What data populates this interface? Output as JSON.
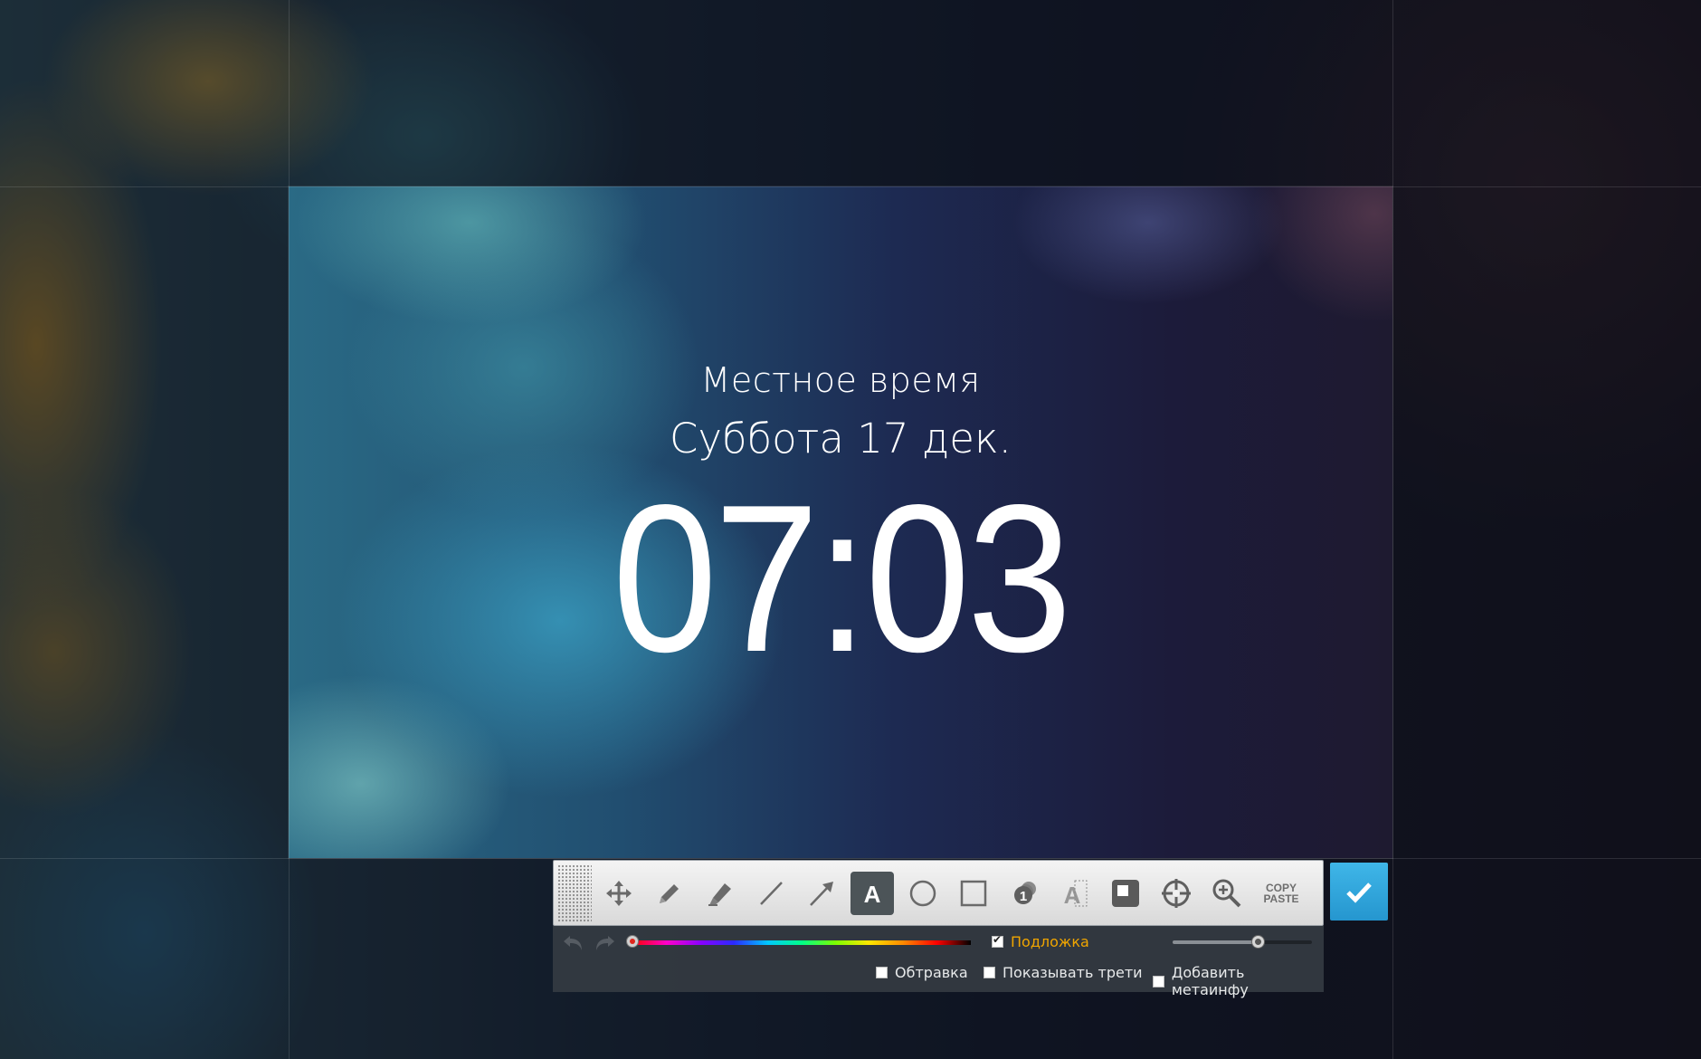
{
  "lockscreen": {
    "label": "Местное время",
    "date": "Суббота 17 дек.",
    "time": "07:03"
  },
  "toolbar": {
    "tools": [
      {
        "name": "move-tool",
        "icon": "move-icon"
      },
      {
        "name": "pencil-tool",
        "icon": "pencil-icon"
      },
      {
        "name": "marker-tool",
        "icon": "marker-icon"
      },
      {
        "name": "line-tool",
        "icon": "line-icon"
      },
      {
        "name": "arrow-tool",
        "icon": "arrow-icon"
      },
      {
        "name": "text-tool",
        "icon": "text-icon",
        "active": true,
        "glyph": "A"
      },
      {
        "name": "ellipse-tool",
        "icon": "ellipse-icon"
      },
      {
        "name": "rectangle-tool",
        "icon": "rectangle-icon"
      },
      {
        "name": "numbering-tool",
        "icon": "numbering-icon",
        "glyph": "1"
      },
      {
        "name": "blur-tool",
        "icon": "blur-text-icon",
        "glyph": "A"
      },
      {
        "name": "shadow-tool",
        "icon": "shadow-icon"
      },
      {
        "name": "crosshair-tool",
        "icon": "crosshair-icon"
      },
      {
        "name": "zoom-tool",
        "icon": "zoom-in-icon"
      }
    ],
    "copy_label": "COPY",
    "paste_label": "PASTE",
    "confirm_icon": "check-icon"
  },
  "options": {
    "substrate_label": "Подложка",
    "substrate_checked": true,
    "outline_label": "Обтравка",
    "outline_checked": false,
    "thirds_label": "Показывать трети",
    "thirds_checked": false,
    "meta_label": "Добавить метаинфу",
    "meta_checked": false,
    "opacity_slider_fraction": 0.62
  },
  "colors": {
    "accent": "#2fa6dc",
    "substrate_label": "#f0a500",
    "selected_color": "#e0271d"
  }
}
